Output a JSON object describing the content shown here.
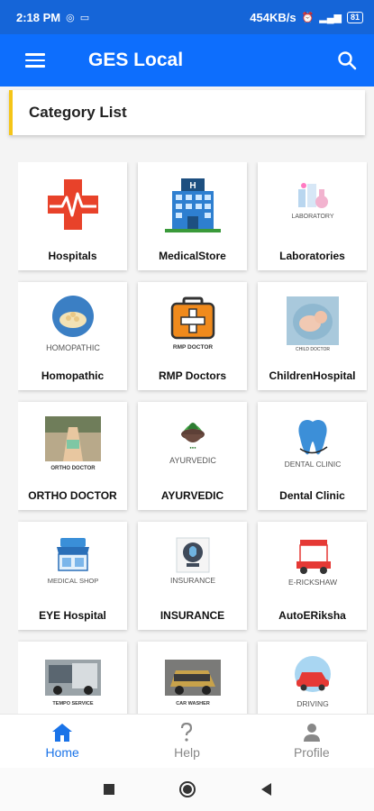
{
  "status_bar": {
    "time": "2:18 PM",
    "speed": "454KB/s",
    "battery": "81"
  },
  "app_bar": {
    "title": "GES Local"
  },
  "category_header": {
    "title": "Category List"
  },
  "categories": [
    {
      "label": "Hospitals",
      "icon": "hospital-cross-icon"
    },
    {
      "label": "MedicalStore",
      "icon": "medical-store-building-icon",
      "image_text": "H"
    },
    {
      "label": "Laboratories",
      "icon": "laboratory-icon",
      "image_text": "LABORATORY"
    },
    {
      "label": "Homopathic",
      "icon": "homeopathic-icon",
      "image_text": "HOMOPATHIC"
    },
    {
      "label": "RMP Doctors",
      "icon": "medical-kit-icon",
      "image_text": "RMP DOCTOR"
    },
    {
      "label": "ChildrenHospital",
      "icon": "child-doctor-photo-icon",
      "image_text": "CHILD DOCTOR"
    },
    {
      "label": "ORTHO DOCTOR",
      "icon": "ortho-doctor-photo-icon",
      "image_text": "ORTHO DOCTOR"
    },
    {
      "label": "AYURVEDIC",
      "icon": "ayurvedic-mortar-icon",
      "image_text": "AYURVEDIC"
    },
    {
      "label": "Dental Clinic",
      "icon": "tooth-icon",
      "image_text": "DENTAL CLINIC"
    },
    {
      "label": "EYE Hospital",
      "icon": "medical-shop-icon",
      "image_text": "MEDICAL SHOP"
    },
    {
      "label": "INSURANCE",
      "icon": "insurance-icon",
      "image_text": "INSURANCE"
    },
    {
      "label": "AutoERiksha",
      "icon": "e-rickshaw-icon",
      "image_text": "E-RICKSHAW"
    },
    {
      "label": "",
      "icon": "tempo-truck-photo-icon",
      "image_text": "TEMPO SERVICE"
    },
    {
      "label": "",
      "icon": "car-washer-photo-icon",
      "image_text": "CAR WASHER"
    },
    {
      "label": "",
      "icon": "driving-car-icon",
      "image_text": "DRIVING"
    }
  ],
  "bottom_nav": [
    {
      "label": "Home",
      "icon": "home-icon",
      "active": true
    },
    {
      "label": "Help",
      "icon": "question-icon",
      "active": false
    },
    {
      "label": "Profile",
      "icon": "person-icon",
      "active": false
    }
  ],
  "colors": {
    "primary": "#0d6efd",
    "accent_bar": "#f5c518",
    "active_nav": "#1a73e8",
    "inactive_nav": "#888888"
  }
}
